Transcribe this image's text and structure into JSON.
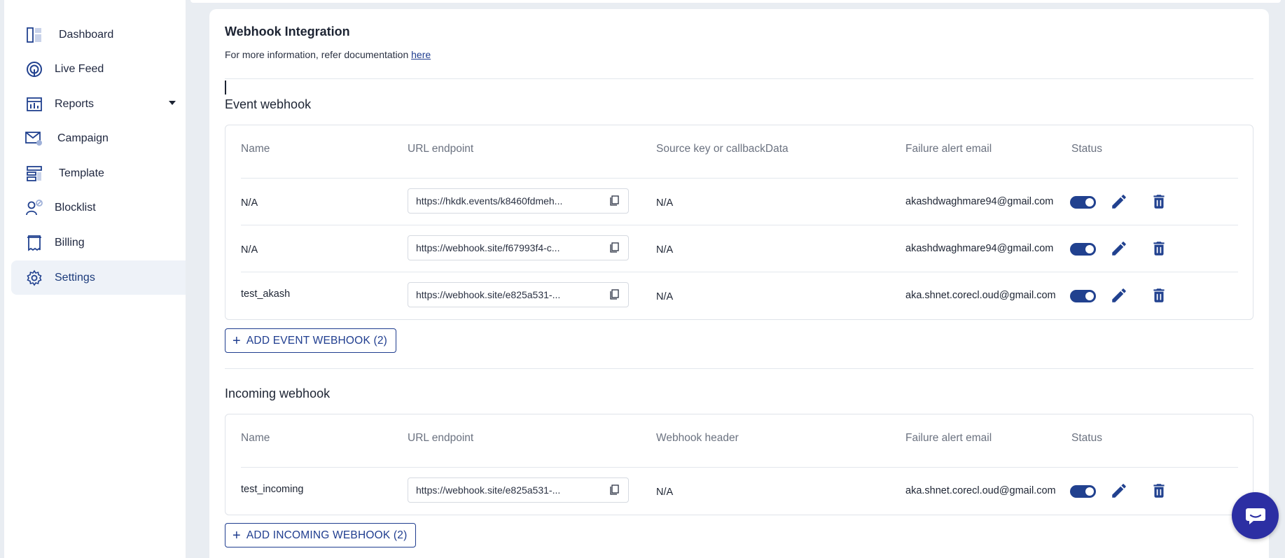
{
  "sidebar": {
    "items": [
      {
        "label": "Dashboard",
        "icon": "dashboard-icon",
        "active": false
      },
      {
        "label": "Live Feed",
        "icon": "live-feed-icon",
        "active": false
      },
      {
        "label": "Reports",
        "icon": "reports-icon",
        "active": false,
        "has_caret": true
      },
      {
        "label": "Campaign",
        "icon": "campaign-icon",
        "active": false
      },
      {
        "label": "Template",
        "icon": "template-icon",
        "active": false
      },
      {
        "label": "Blocklist",
        "icon": "blocklist-icon",
        "active": false
      },
      {
        "label": "Billing",
        "icon": "billing-icon",
        "active": false
      },
      {
        "label": "Settings",
        "icon": "settings-icon",
        "active": true
      }
    ]
  },
  "main": {
    "title": "Webhook Integration",
    "info_text": "For more information, refer documentation ",
    "info_link": "here",
    "event": {
      "title": "Event webhook",
      "columns": [
        "Name",
        "URL endpoint",
        "Source key or callbackData",
        "Failure alert email",
        "Status"
      ],
      "rows": [
        {
          "name": "N/A",
          "url": "https://hkdk.events/k8460fdmeh...",
          "source": "N/A",
          "email": "akashdwaghmare94@gmail.com",
          "enabled": true
        },
        {
          "name": "N/A",
          "url": "https://webhook.site/f67993f4-c...",
          "source": "N/A",
          "email": "akashdwaghmare94@gmail.com",
          "enabled": true
        },
        {
          "name": "test_akash",
          "url": "https://webhook.site/e825a531-...",
          "source": "N/A",
          "email": "aka.shnet.corecl.oud@gmail.com",
          "enabled": true
        }
      ],
      "add_label": "ADD EVENT WEBHOOK (2)"
    },
    "incoming": {
      "title": "Incoming webhook",
      "columns": [
        "Name",
        "URL endpoint",
        "Webhook header",
        "Failure alert email",
        "Status"
      ],
      "rows": [
        {
          "name": "test_incoming",
          "url": "https://webhook.site/e825a531-...",
          "source": "N/A",
          "email": "aka.shnet.corecl.oud@gmail.com",
          "enabled": true
        }
      ],
      "add_label": "ADD INCOMING WEBHOOK (2)"
    }
  },
  "colors": {
    "accent": "#21418f",
    "link": "#1f3d8f",
    "chat": "#2c2fa3"
  }
}
